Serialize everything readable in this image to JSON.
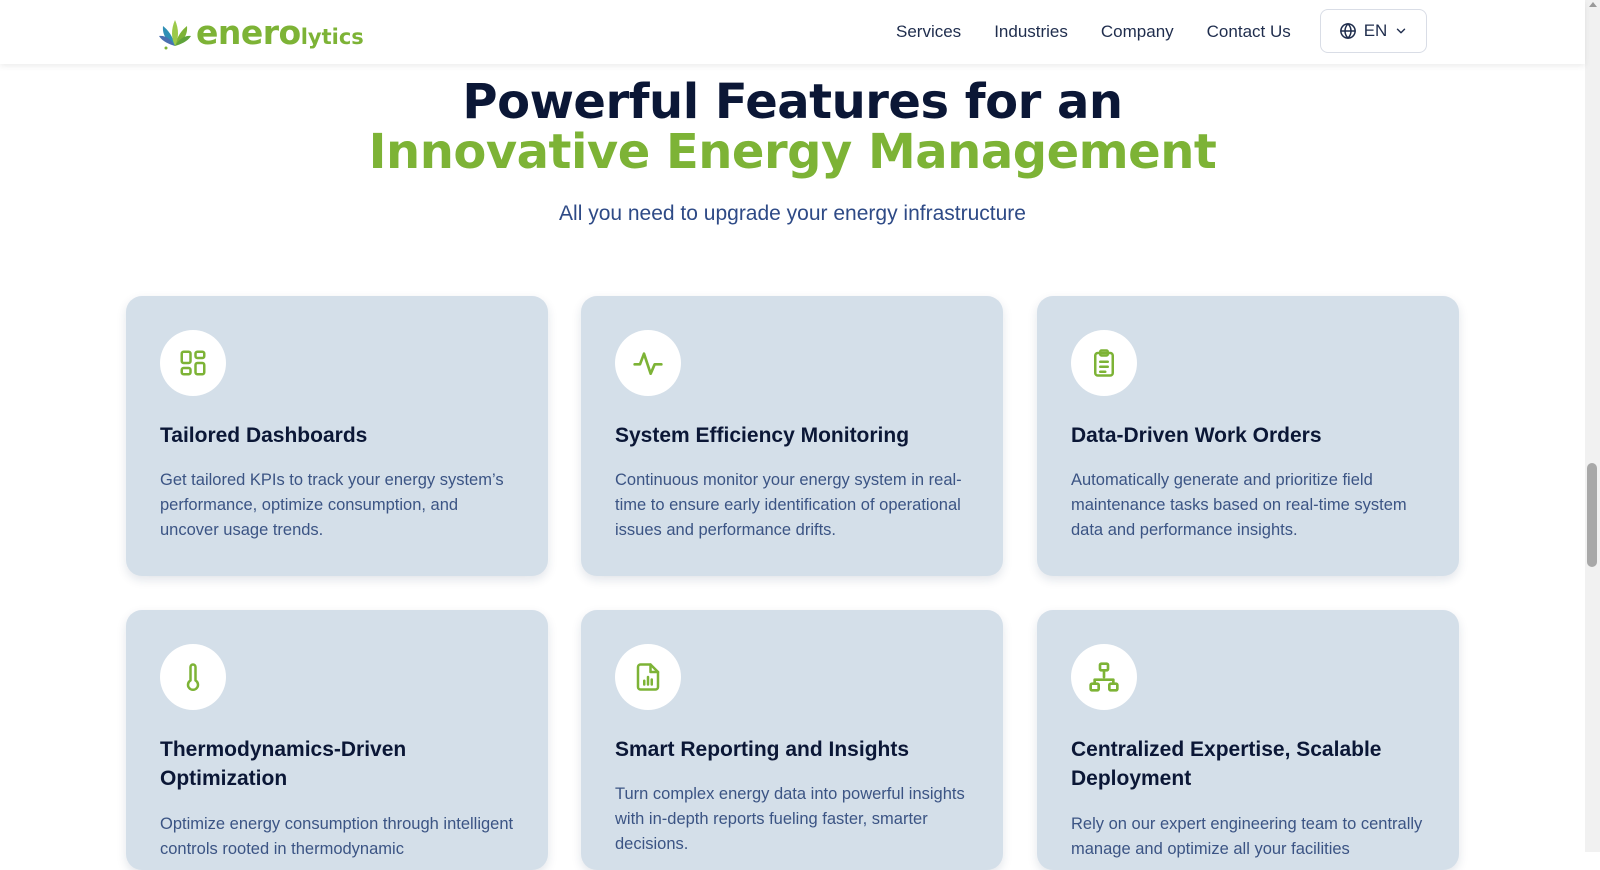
{
  "brand": {
    "name_main": "enero",
    "name_sub": "lytics"
  },
  "nav": {
    "items": [
      "Services",
      "Industries",
      "Company",
      "Contact Us"
    ],
    "language": "EN"
  },
  "hero": {
    "title_line1": "Powerful Features for an",
    "title_line2": "Innovative Energy Management",
    "subtitle": "All you need to upgrade your energy infrastructure"
  },
  "features": [
    {
      "icon": "dashboard-icon",
      "title": "Tailored Dashboards",
      "description": "Get tailored KPIs to track your energy system’s performance, optimize consumption, and uncover usage trends."
    },
    {
      "icon": "activity-pulse-icon",
      "title": "System Efficiency Monitoring",
      "description": "Continuous monitor your energy system in real-time to ensure early identification of operational issues and performance drifts."
    },
    {
      "icon": "clipboard-list-icon",
      "title": "Data-Driven Work Orders",
      "description": "Automatically generate and prioritize field maintenance tasks based on real-time system data and performance insights."
    },
    {
      "icon": "thermometer-icon",
      "title": "Thermodynamics-Driven Optimization",
      "description": "Optimize energy consumption through intelligent controls rooted in thermodynamic"
    },
    {
      "icon": "report-chart-icon",
      "title": "Smart Reporting and Insights",
      "description": "Turn complex energy data into powerful insights with in-depth reports fueling faster, smarter decisions."
    },
    {
      "icon": "network-hierarchy-icon",
      "title": "Centralized Expertise, Scalable Deployment",
      "description": "Rely on our expert engineering team to centrally manage and optimize all your facilities"
    }
  ],
  "colors": {
    "accent": "#7db336",
    "navy": "#0b1736",
    "card": "#d4dfe9",
    "body_text": "#3b5484"
  }
}
